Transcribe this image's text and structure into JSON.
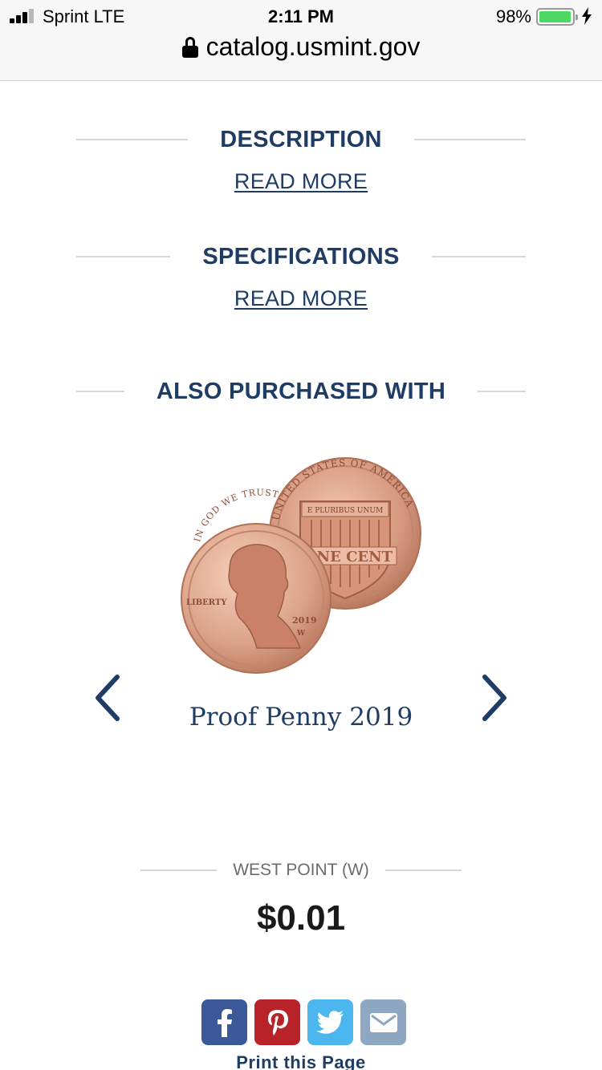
{
  "status_bar": {
    "carrier": "Sprint  LTE",
    "time": "2:11 PM",
    "battery_percent": "98%",
    "battery_level": 0.98,
    "signal_bars": 3
  },
  "url_bar": {
    "domain": "catalog.usmint.gov",
    "lock_icon": "lock-icon"
  },
  "sections": {
    "description": {
      "title": "DESCRIPTION",
      "link": "READ MORE"
    },
    "specifications": {
      "title": "SPECIFICATIONS",
      "link": "READ MORE"
    },
    "also_purchased": {
      "title": "ALSO PURCHASED WITH"
    }
  },
  "carousel": {
    "product_name": "Proof Penny 2019",
    "prev_icon": "chevron-left-icon",
    "next_icon": "chevron-right-icon",
    "coin_texts": {
      "obverse_motto": "IN GOD WE TRUST",
      "obverse_liberty": "LIBERTY",
      "obverse_year": "2019",
      "obverse_mint": "W",
      "reverse_rim": "UNITED STATES OF AMERICA",
      "reverse_motto": "E PLURIBUS UNUM",
      "reverse_value": "ONE CENT"
    }
  },
  "price_block": {
    "mint": "WEST POINT (W)",
    "price": "$0.01"
  },
  "share": {
    "facebook_icon": "facebook-icon",
    "pinterest_icon": "pinterest-icon",
    "twitter_icon": "twitter-icon",
    "email_icon": "email-icon",
    "print_label": "Print this Page"
  },
  "colors": {
    "navy": "#1f3c64",
    "facebook": "#3b5998",
    "pinterest": "#b8232a",
    "twitter": "#4cb6ee",
    "email": "#8ea7c2",
    "copper": "#d9a48a"
  }
}
